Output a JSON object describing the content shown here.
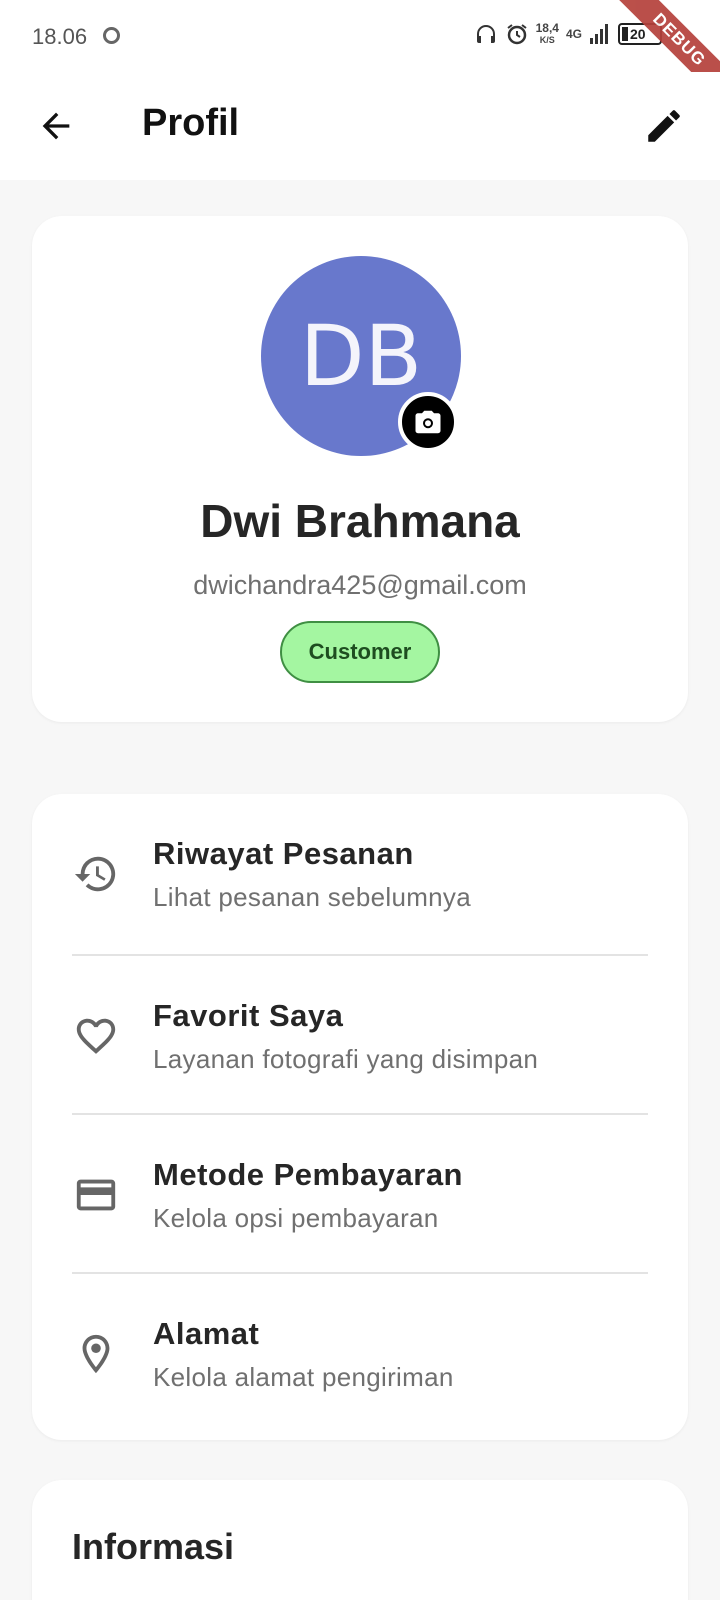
{
  "status_bar": {
    "time": "18.06",
    "network_speed_value": "18,4",
    "network_speed_unit": "K/S",
    "network_type": "4G",
    "battery_level": "20",
    "debug_banner": "DEBUG"
  },
  "app_bar": {
    "title": "Profil"
  },
  "profile": {
    "avatar_initials": "DB",
    "avatar_color": "#6878cc",
    "name": "Dwi Brahmana",
    "email": "dwichandra425@gmail.com",
    "role": "Customer",
    "role_color": "#a4f6a1"
  },
  "menu": {
    "items": [
      {
        "icon": "history-icon",
        "title": "Riwayat Pesanan",
        "subtitle": "Lihat pesanan sebelumnya"
      },
      {
        "icon": "heart-icon",
        "title": "Favorit Saya",
        "subtitle": "Layanan fotografi yang disimpan"
      },
      {
        "icon": "credit-card-icon",
        "title": "Metode Pembayaran",
        "subtitle": "Kelola opsi pembayaran"
      },
      {
        "icon": "location-pin-icon",
        "title": "Alamat",
        "subtitle": "Kelola alamat pengiriman"
      }
    ]
  },
  "info_section": {
    "title": "Informasi"
  }
}
